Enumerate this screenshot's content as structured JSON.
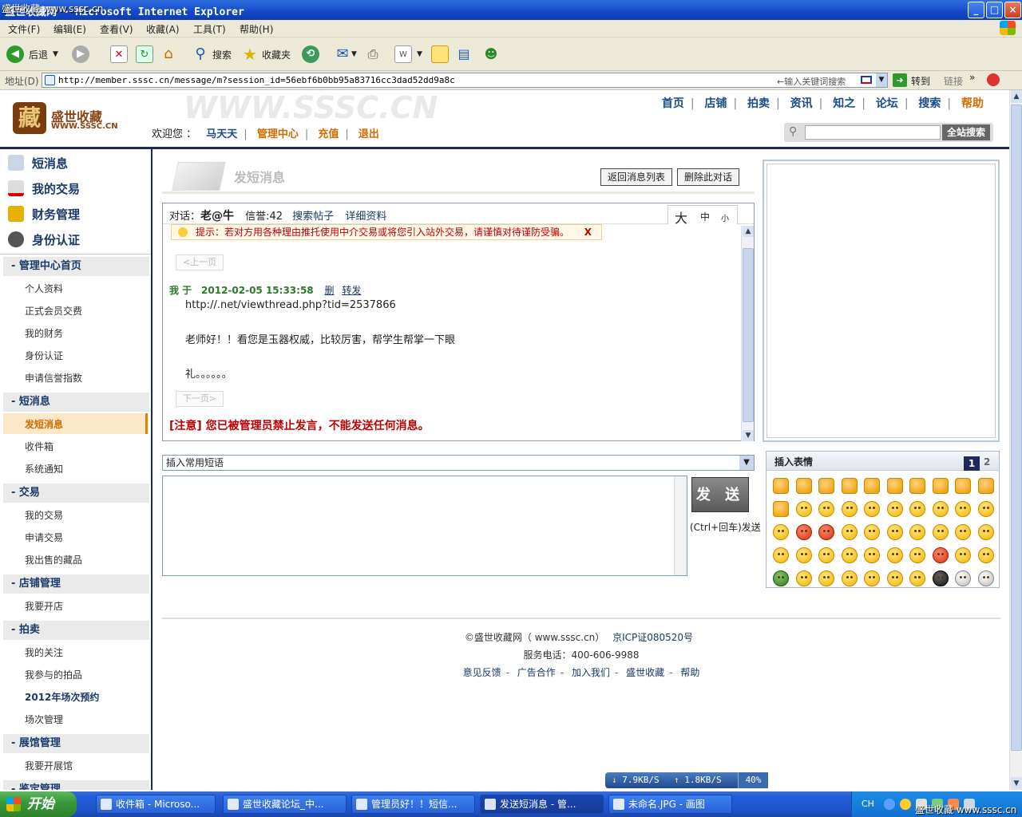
{
  "window": {
    "title": "盛世收藏网 - Microsoft Internet Explorer",
    "corner_title_fragment": "管理中心 - ",
    "watermark_top": "盛世收藏 www.sssc.cn",
    "watermark_bottom": "盛世收藏  www.sssc.cn"
  },
  "menu": [
    "文件(F)",
    "编辑(E)",
    "查看(V)",
    "收藏(A)",
    "工具(T)",
    "帮助(H)"
  ],
  "toolbar": {
    "back": "后退",
    "search": "搜索",
    "favorites": "收藏夹"
  },
  "address": {
    "label": "地址(D)",
    "url": "http://member.sssc.cn/message/m?session_id=56ebf6b0bb95a83716cc3dad52dd9a8c",
    "keyword_hint": "←输入关键词搜索",
    "go": "转到",
    "links": "链接"
  },
  "site": {
    "logo_char": "藏",
    "logo_name": "盛世收藏",
    "logo_url": "WWW.SSSC.CN",
    "header_watermark": "WWW.SSSC.CN",
    "topnav": [
      "首页",
      "店铺",
      "拍卖",
      "资讯",
      "知之",
      "论坛",
      "搜索",
      "帮助"
    ],
    "welcome_label": "欢迎您 ：",
    "username": "马天天",
    "user_links": [
      "管理中心",
      "充值",
      "退出"
    ],
    "search_button": "全站搜索"
  },
  "sidebar": {
    "main": [
      "短消息",
      "我的交易",
      "财务管理",
      "身份认证"
    ],
    "sections": [
      {
        "title": "-  管理中心首页",
        "items": [
          "个人资料",
          "正式会员交费",
          "我的财务",
          "身份认证",
          "申请信誉指数"
        ]
      },
      {
        "title": "-  短消息",
        "items": [
          "发短消息",
          "收件箱",
          "系统通知"
        ]
      },
      {
        "title": "-  交易",
        "items": [
          "我的交易",
          "申请交易",
          "我出售的藏品"
        ]
      },
      {
        "title": "-  店铺管理",
        "items": [
          "我要开店"
        ]
      },
      {
        "title": "-  拍卖",
        "items": [
          "我的关注",
          "我参与的拍品",
          "2012年场次预约",
          "场次管理"
        ]
      },
      {
        "title": "-  展馆管理",
        "items": [
          "我要开展馆"
        ]
      },
      {
        "title": "-  鉴定管理",
        "items": []
      }
    ]
  },
  "compose": {
    "title": "发短消息",
    "back_button": "返回消息列表",
    "delete_button": "删除此对话"
  },
  "conversation": {
    "label": "对话：",
    "partner": "老@牛",
    "credit": "信誉:42",
    "search_posts": "搜索帖子",
    "details": "详细资料",
    "font_sizes": [
      "大",
      "中",
      "小"
    ],
    "tip": "提示：若对方用各种理由推托使用中介交易或将您引入站外交易，请谨慎对待谨防受骗。",
    "tip_close": "X",
    "prev": "<上一页",
    "next": "下一页>",
    "sender": "我  于",
    "timestamp": "2012-02-05 15:33:58",
    "delete": "删",
    "forward": "转发",
    "lines": [
      "http://.net/viewthread.php?tid=2537866",
      "老师好！！看您是玉器权威，比较厉害，帮学生帮掌一下眼",
      "礼。。。。。。"
    ],
    "banned_notice": "[注意] 您已被管理员禁止发言，不能发送任何消息。"
  },
  "reply": {
    "phrase_select": "插入常用短语",
    "send_button": "发 送",
    "send_hint": "(Ctrl+回车)发送"
  },
  "emoticons": {
    "title": "插入表情",
    "pages": [
      "1",
      "2"
    ],
    "current_page": 1
  },
  "footer": {
    "copyright": "©盛世收藏网（ www.sssc.cn）",
    "icp": "京ICP证080520号",
    "phone": "服务电话：400-606-9988",
    "links": [
      "意见反馈",
      "广告合作",
      "加入我们",
      "盛世收藏",
      "帮助"
    ]
  },
  "speed": {
    "down": "7.9KB/S",
    "up": "1.8KB/S",
    "percent": "40%"
  },
  "taskbar": {
    "start": "开始",
    "tasks": [
      "收件箱 - Microso...",
      "盛世收藏论坛_中...",
      "管理员好！！短信...",
      "发送短消息 - 管...",
      "未命名.JPG - 画图"
    ],
    "lang": "CH"
  }
}
